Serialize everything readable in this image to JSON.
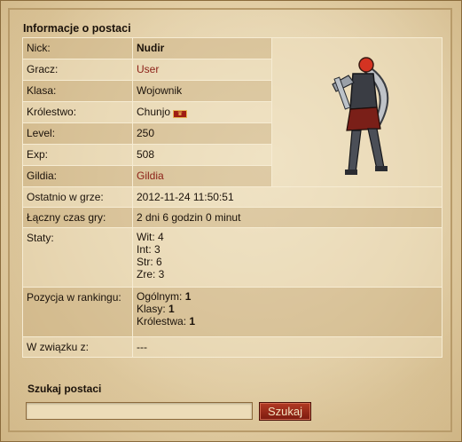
{
  "title": "Informacje o postaci",
  "rows": [
    {
      "label": "Nick:",
      "value": "Nudir"
    },
    {
      "label": "Gracz:",
      "value": "User"
    },
    {
      "label": "Klasa:",
      "value": "Wojownik"
    },
    {
      "label": "Królestwo:",
      "value": "Chunjo"
    },
    {
      "label": "Level:",
      "value": "250"
    },
    {
      "label": "Exp:",
      "value": "508"
    },
    {
      "label": "Gildia:",
      "value": "Gildia"
    },
    {
      "label": "Ostatnio w grze:",
      "value": "2012-11-24 11:50:51"
    },
    {
      "label": "Łączny czas gry:",
      "value": "2 dni 6 godzin 0 minut"
    },
    {
      "label": "Staty:",
      "lines": [
        "Wit: 4",
        "Int: 3",
        "Str: 6",
        "Zre: 3"
      ]
    },
    {
      "label": "Pozycja w rankingu:",
      "ranks": [
        {
          "label": "Ogólnym:",
          "value": "1"
        },
        {
          "label": "Klasy:",
          "value": "1"
        },
        {
          "label": "Królestwa:",
          "value": "1"
        }
      ]
    },
    {
      "label": "W związku z:",
      "value": "---"
    }
  ],
  "kingdom_flag": "chunjo-kingdom-flag-icon",
  "search": {
    "title": "Szukaj postaci",
    "input_value": "",
    "button_label": "Szukaj"
  },
  "colors": {
    "link": "#8b1f17",
    "button": "#9e2d1b"
  }
}
